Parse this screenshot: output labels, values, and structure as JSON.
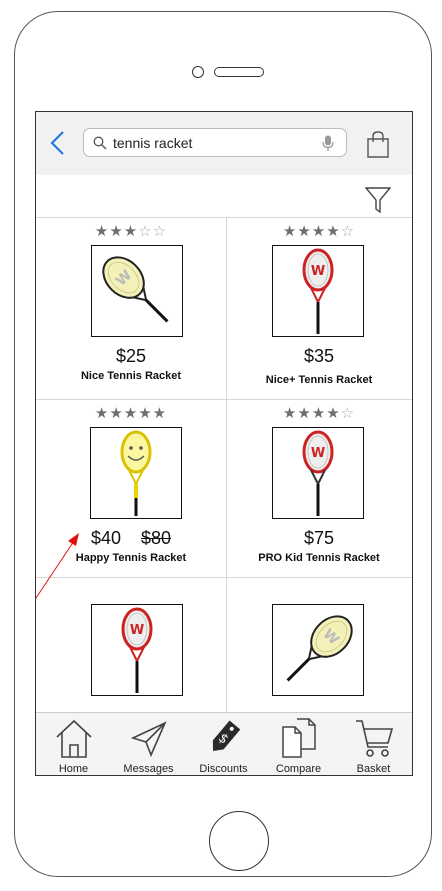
{
  "search": {
    "query": "tennis racket"
  },
  "products": [
    {
      "name": "Nice Tennis Racket",
      "price": "$25",
      "old_price": "",
      "rating": 3,
      "style": "diagonal-yellow"
    },
    {
      "name": "Nice+ Tennis Racket",
      "price": "$35",
      "old_price": "",
      "rating": 4,
      "style": "vertical-red"
    },
    {
      "name": "Happy Tennis Racket",
      "price": "$40",
      "old_price": "$80",
      "rating": 5,
      "style": "vertical-yellow-smiley"
    },
    {
      "name": "PRO Kid Tennis Racket",
      "price": "$75",
      "old_price": "",
      "rating": 4,
      "style": "vertical-red-small"
    },
    {
      "name": "",
      "price": "",
      "old_price": "",
      "rating": null,
      "style": "vertical-red"
    },
    {
      "name": "",
      "price": "",
      "old_price": "",
      "rating": null,
      "style": "diagonal-yellow"
    }
  ],
  "tabs": [
    {
      "label": "Home",
      "icon": "home-icon"
    },
    {
      "label": "Messages",
      "icon": "paper-plane-icon"
    },
    {
      "label": "Discounts",
      "icon": "price-tag-icon"
    },
    {
      "label": "Compare",
      "icon": "compare-documents-icon"
    },
    {
      "label": "Basket",
      "icon": "cart-icon"
    }
  ],
  "colors": {
    "accent": "#1a73e8",
    "annotation": "#e01010",
    "star": "#6f6f6f"
  }
}
